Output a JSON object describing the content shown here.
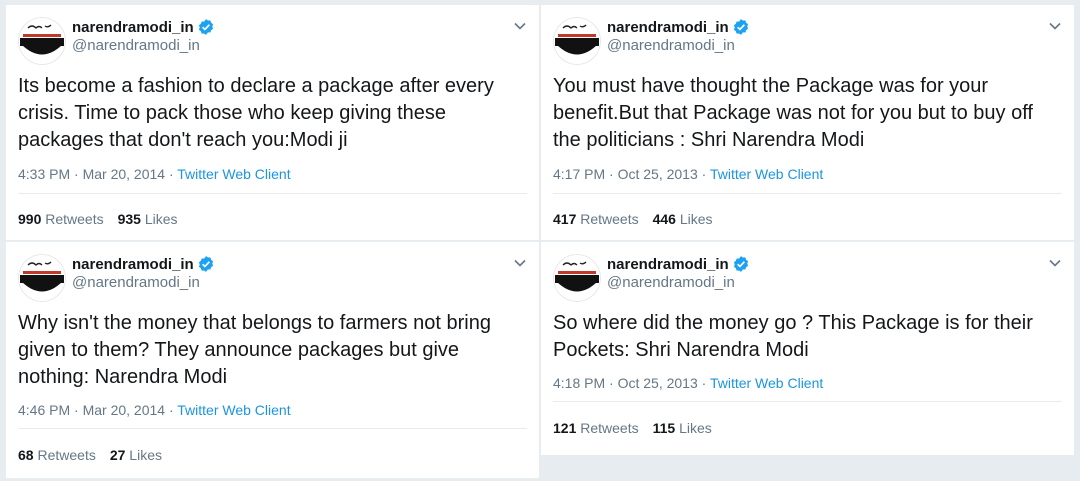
{
  "account": {
    "display_name": "narendramodi_in",
    "handle": "@narendramodi_in"
  },
  "tweets": [
    {
      "text": "Its become a fashion to declare a package after every\ncrisis. Time to pack those who keep giving these\npackages that don't reach you:Modi ji",
      "time": "4:33 PM · Mar 20, 2014 · ",
      "client": "Twitter Web Client",
      "retweets": "990",
      "retweets_label": "Retweets",
      "likes": "935",
      "likes_label": "Likes"
    },
    {
      "text": "You must have thought the Package was for your\nbenefit.But that Package was not for you but to buy off\nthe politicians : Shri Narendra Modi",
      "time": "4:17 PM · Oct 25, 2013 · ",
      "client": "Twitter Web Client",
      "retweets": "417",
      "retweets_label": "Retweets",
      "likes": "446",
      "likes_label": "Likes"
    },
    {
      "text": "Why isn't the money that belongs to farmers not bring\ngiven to them? They announce packages but give\nnothing: Narendra Modi",
      "time": "4:46 PM · Mar 20, 2014 · ",
      "client": "Twitter Web Client",
      "retweets": "68",
      "retweets_label": "Retweets",
      "likes": "27",
      "likes_label": "Likes"
    },
    {
      "text": "So where did the money go ? This Package is for their\nPockets: Shri Narendra Modi",
      "time": "4:18 PM · Oct 25, 2013 · ",
      "client": "Twitter Web Client",
      "retweets": "121",
      "retweets_label": "Retweets",
      "likes": "115",
      "likes_label": "Likes"
    }
  ],
  "colors": {
    "background": "#e6ecf0",
    "text": "#14171a",
    "secondary": "#657786",
    "link": "#1b95e0",
    "verified": "#1da1f2"
  },
  "icons": [
    "verified-badge-icon",
    "chevron-down-icon",
    "avatar-logo"
  ]
}
